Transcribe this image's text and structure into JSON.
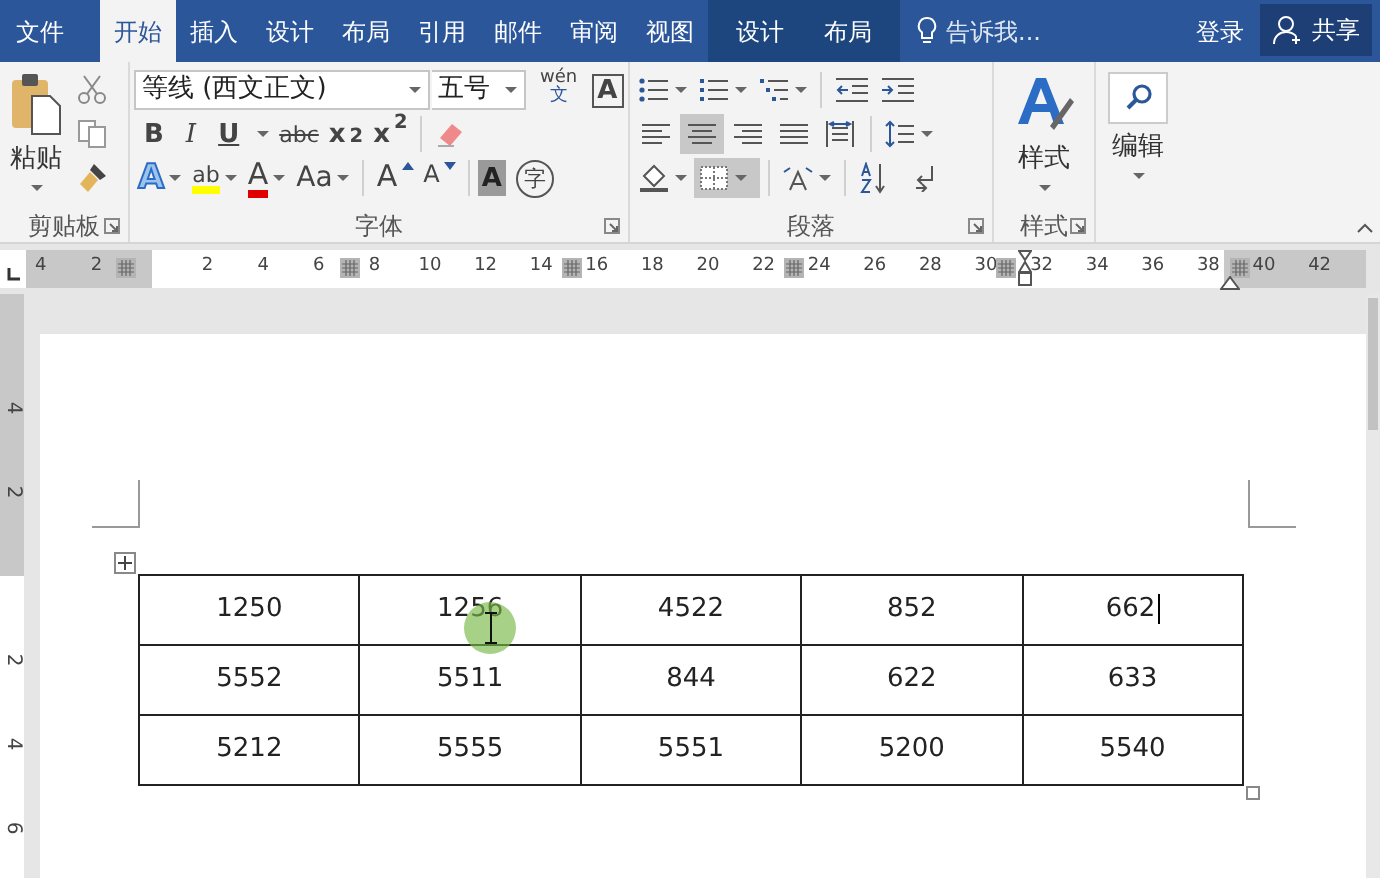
{
  "tabs": [
    {
      "label": "文件",
      "selected": false,
      "kind": "file"
    },
    {
      "label": "开始",
      "selected": true,
      "kind": "main"
    },
    {
      "label": "插入",
      "selected": false,
      "kind": "main"
    },
    {
      "label": "设计",
      "selected": false,
      "kind": "main"
    },
    {
      "label": "布局",
      "selected": false,
      "kind": "main"
    },
    {
      "label": "引用",
      "selected": false,
      "kind": "main"
    },
    {
      "label": "邮件",
      "selected": false,
      "kind": "main"
    },
    {
      "label": "审阅",
      "selected": false,
      "kind": "main"
    },
    {
      "label": "视图",
      "selected": false,
      "kind": "main"
    },
    {
      "label": "设计",
      "selected": false,
      "kind": "context"
    },
    {
      "label": "布局",
      "selected": false,
      "kind": "context"
    }
  ],
  "tell_me": "告诉我...",
  "sign_in": "登录",
  "share": "共享",
  "ribbon": {
    "clipboard": {
      "label": "剪贴板",
      "paste": "粘贴"
    },
    "font": {
      "label": "字体",
      "font_name": "等线 (西文正文)",
      "font_size": "五号",
      "phonetic": {
        "top": "wén",
        "bottom": "文"
      },
      "border_char": "A",
      "format": [
        {
          "kind": "bold",
          "text": "B"
        },
        {
          "kind": "italic",
          "text": "I"
        },
        {
          "kind": "underline",
          "text": "U"
        },
        {
          "kind": "strike",
          "text": "abc"
        },
        {
          "kind": "subscript",
          "text": "x$_{2}$"
        },
        {
          "kind": "superscript",
          "text": "x$^{2}$"
        }
      ],
      "effects": [
        {
          "kind": "text-effect",
          "text": "A"
        },
        {
          "kind": "highlight",
          "text": "ab"
        },
        {
          "kind": "font-color",
          "text": "A"
        },
        {
          "kind": "case",
          "text": "Aa"
        }
      ],
      "size_buttons": [
        {
          "kind": "grow",
          "text": "A"
        },
        {
          "kind": "shrink",
          "text": "A"
        }
      ],
      "shading_char": "A",
      "enclose_char": "字"
    },
    "paragraph": {
      "label": "段落",
      "alignment": [
        {
          "kind": "left",
          "selected": false
        },
        {
          "kind": "center",
          "selected": true
        },
        {
          "kind": "right",
          "selected": false
        },
        {
          "kind": "justify",
          "selected": false
        },
        {
          "kind": "distributed",
          "selected": false
        }
      ],
      "borders": {
        "selected": true
      }
    },
    "styles": {
      "button": "样式",
      "label": "样式"
    },
    "editing": {
      "button": "编辑"
    }
  },
  "ruler": {
    "left_labels": [
      "4",
      "2"
    ],
    "labels": [
      "2",
      "4",
      "6",
      "8",
      "10",
      "12",
      "14",
      "16",
      "18",
      "20",
      "22",
      "24",
      "26",
      "28",
      "30",
      "32",
      "34",
      "36",
      "38",
      "40",
      "42"
    ]
  },
  "vertical_ruler": {
    "top_labels": [
      "4",
      "2"
    ],
    "labels": [
      "2",
      "4",
      "6"
    ]
  },
  "table": {
    "rows": [
      [
        {
          "text": "1250",
          "caret": false
        },
        {
          "text": "1256",
          "caret": false
        },
        {
          "text": "4522",
          "caret": false
        },
        {
          "text": "852",
          "caret": false
        },
        {
          "text": "662",
          "caret": true
        }
      ],
      [
        {
          "text": "5552",
          "caret": false
        },
        {
          "text": "5511",
          "caret": false
        },
        {
          "text": "844",
          "caret": false
        },
        {
          "text": "622",
          "caret": false
        },
        {
          "text": "633",
          "caret": false
        }
      ],
      [
        {
          "text": "5212",
          "caret": false
        },
        {
          "text": "5555",
          "caret": false
        },
        {
          "text": "5551",
          "caret": false
        },
        {
          "text": "5200",
          "caret": false
        },
        {
          "text": "5540",
          "caret": false
        }
      ]
    ]
  },
  "pointer": {
    "kind": "click"
  }
}
